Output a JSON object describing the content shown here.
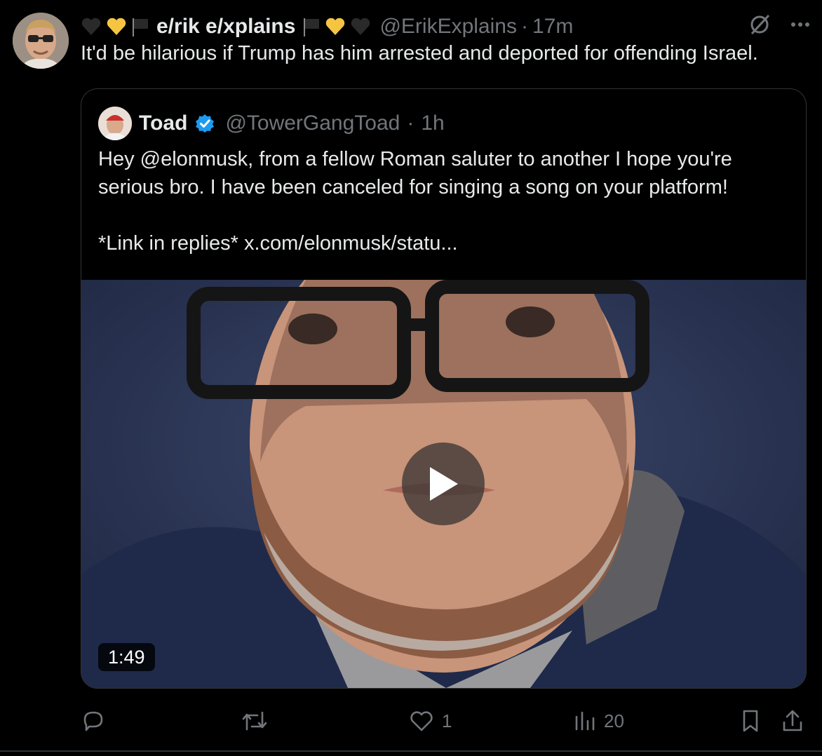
{
  "tweet": {
    "author": {
      "display_name": "e/rik e/xplains",
      "handle": "@ErikExplains",
      "time": "17m",
      "decor_left": [
        "black-heart-icon",
        "yellow-heart-icon",
        "black-flag-icon"
      ],
      "decor_right": [
        "black-flag-icon",
        "yellow-heart-icon",
        "black-heart-icon"
      ]
    },
    "text": "It'd be hilarious if Trump has him arrested and deported for offending Israel.",
    "separator": "·"
  },
  "quote": {
    "author": {
      "display_name": "Toad",
      "handle": "@TowerGangToad",
      "time": "1h",
      "verified": true
    },
    "lines": [
      "Hey @elonmusk, from a fellow Roman saluter to another I hope you're",
      "serious bro. I have been canceled for singing a song on your platform!",
      "",
      "*Link in replies*  x.com/elonmusk/statu..."
    ],
    "video": {
      "duration": "1:49"
    }
  },
  "actions": {
    "reply_count": "",
    "repost_count": "",
    "like_count": "1",
    "views_count": "20"
  },
  "colors": {
    "background": "#000000",
    "text": "#e7e9ea",
    "muted": "#71767b",
    "verified": "#1d9bf0",
    "heart_yellow": "#f5c542",
    "heart_black": "#2a2a2a"
  }
}
